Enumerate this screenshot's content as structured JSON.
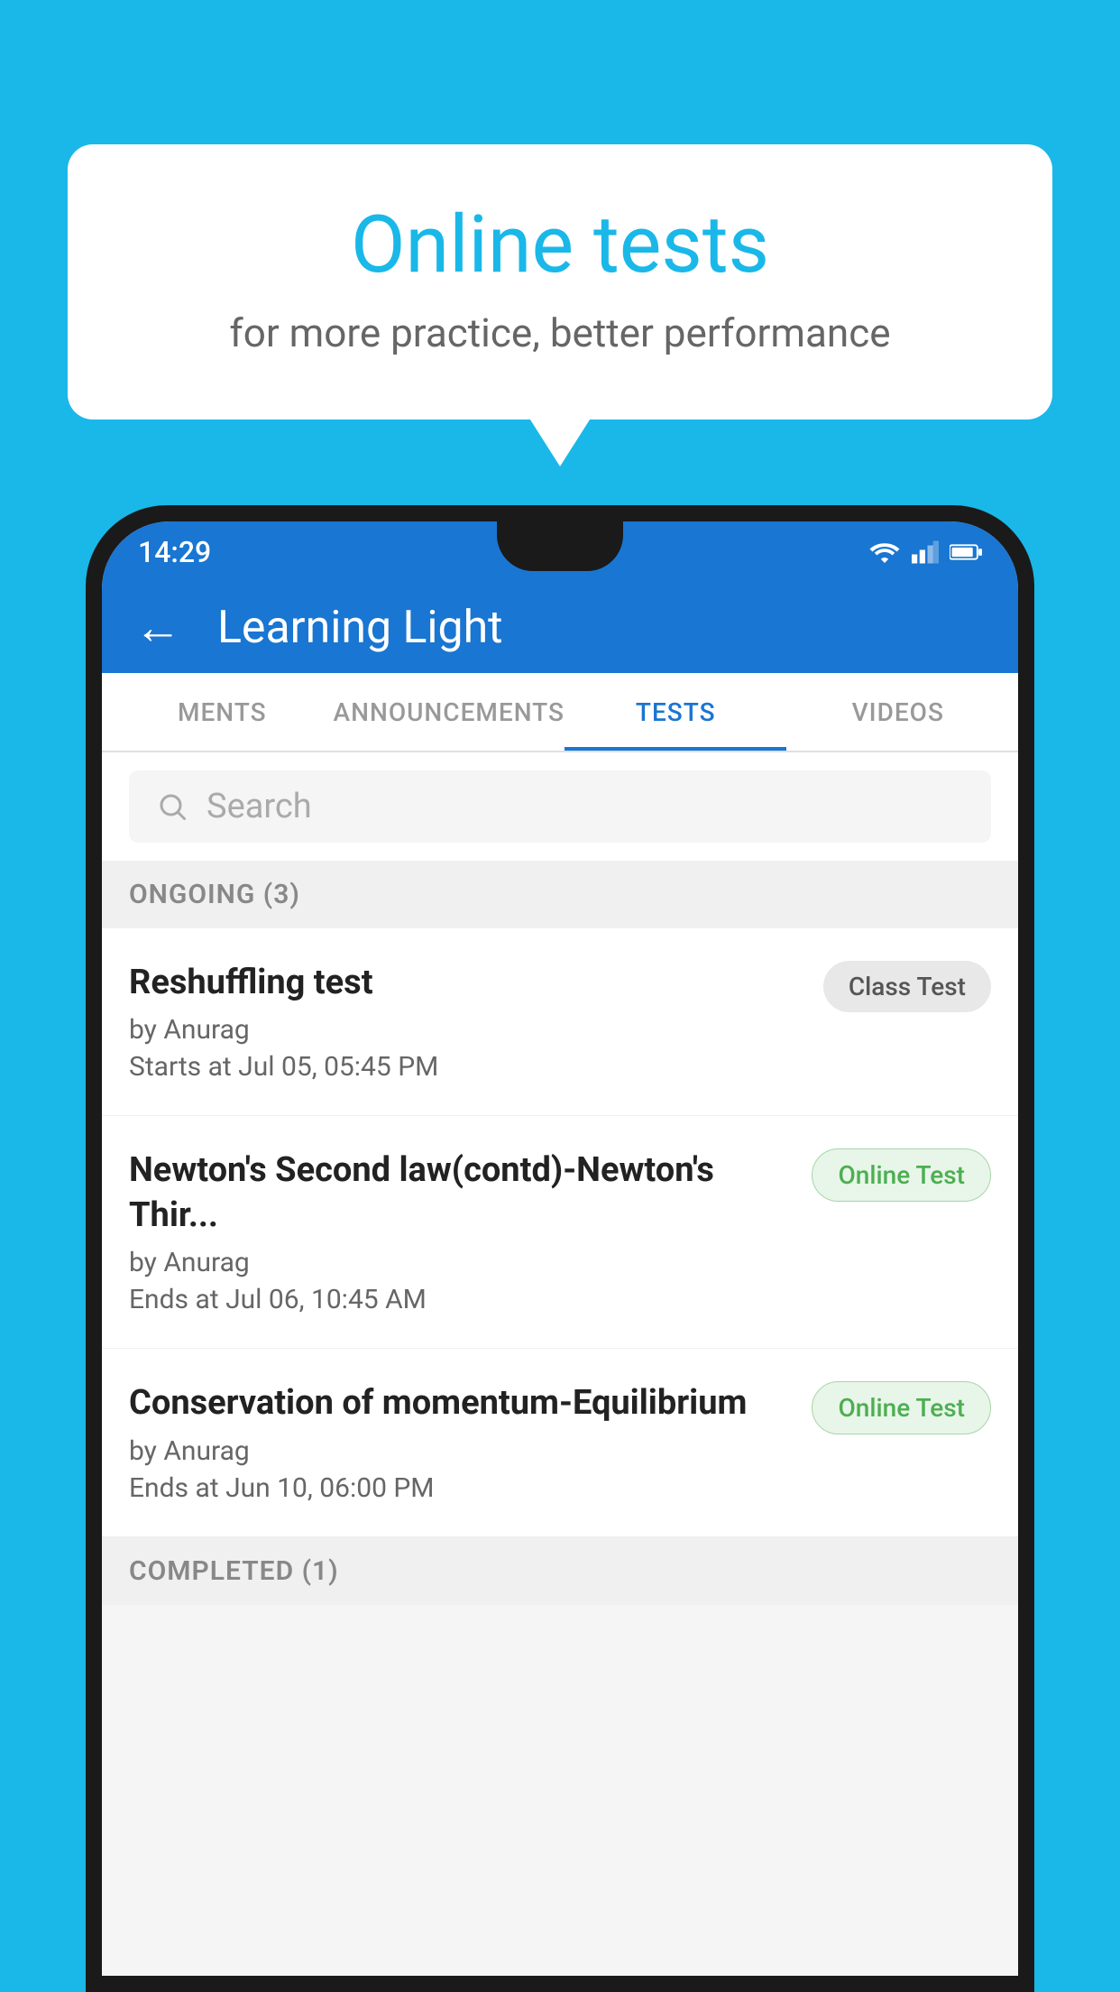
{
  "background": {
    "color": "#1ab8e8"
  },
  "speech_bubble": {
    "title": "Online tests",
    "subtitle": "for more practice, better performance"
  },
  "phone": {
    "status_bar": {
      "time": "14:29",
      "icons": [
        "wifi",
        "signal",
        "battery"
      ]
    },
    "app_bar": {
      "back_label": "←",
      "title": "Learning Light"
    },
    "tabs": [
      {
        "label": "MENTS",
        "active": false
      },
      {
        "label": "ANNOUNCEMENTS",
        "active": false
      },
      {
        "label": "TESTS",
        "active": true
      },
      {
        "label": "VIDEOS",
        "active": false
      }
    ],
    "search": {
      "placeholder": "Search"
    },
    "ongoing_section": {
      "label": "ONGOING (3)"
    },
    "test_items": [
      {
        "name": "Reshuffling test",
        "author": "by Anurag",
        "time_label": "Starts at",
        "time": "Jul 05, 05:45 PM",
        "badge": "Class Test",
        "badge_type": "class"
      },
      {
        "name": "Newton's Second law(contd)-Newton's Thir...",
        "author": "by Anurag",
        "time_label": "Ends at",
        "time": "Jul 06, 10:45 AM",
        "badge": "Online Test",
        "badge_type": "online"
      },
      {
        "name": "Conservation of momentum-Equilibrium",
        "author": "by Anurag",
        "time_label": "Ends at",
        "time": "Jun 10, 06:00 PM",
        "badge": "Online Test",
        "badge_type": "online"
      }
    ],
    "completed_section": {
      "label": "COMPLETED (1)"
    }
  }
}
